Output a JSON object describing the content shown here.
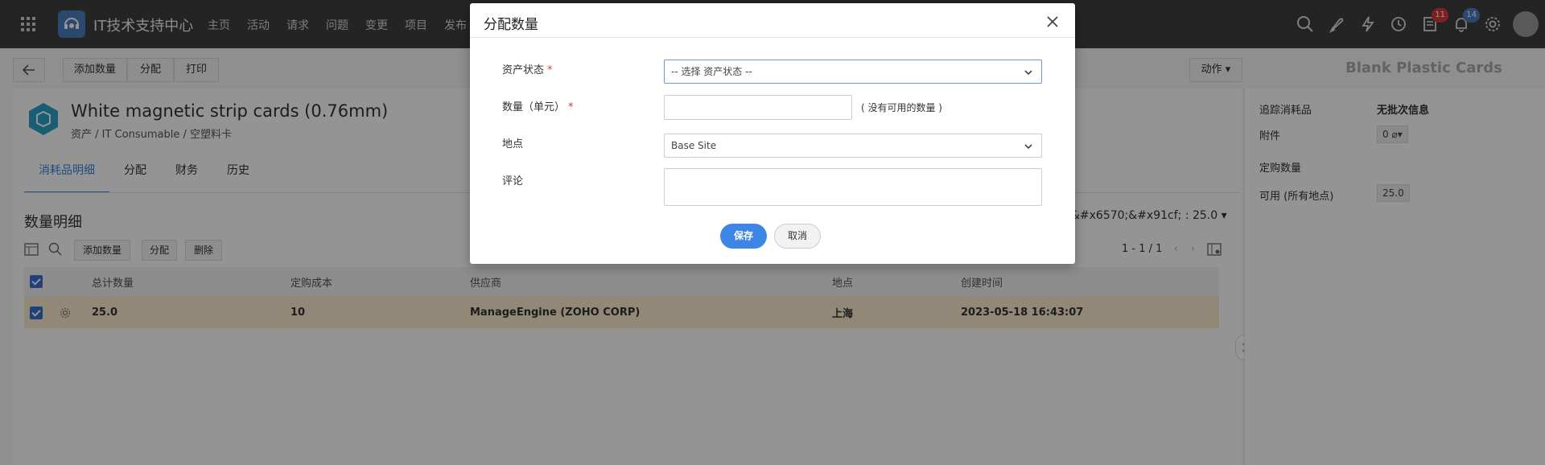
{
  "topbar": {
    "app_title": "IT技术支持中心",
    "nav": [
      "主页",
      "活动",
      "请求",
      "问题",
      "变更",
      "项目",
      "发布"
    ],
    "notifications_badge": "11",
    "alerts_badge": "14"
  },
  "toolbar": {
    "add_qty": "添加数量",
    "assign": "分配",
    "print": "打印",
    "actions": "动作",
    "right_title": "Blank Plastic Cards"
  },
  "asset": {
    "title": "White magnetic strip cards (0.76mm)",
    "breadcrumb": "资产  /  IT Consumable /  空塑料卡"
  },
  "tabs": [
    "消耗品明细",
    "分配",
    "财务",
    "历史"
  ],
  "section": {
    "title": "数量明细",
    "filter_text": "&#x6570;&#x91cf; : 25.0",
    "add_qty": "添加数量",
    "assign": "分配",
    "delete": "删除",
    "pager": "1 - 1 / 1"
  },
  "table": {
    "headers": [
      "总计数量",
      "定购成本",
      "供应商",
      "地点",
      "创建时间"
    ],
    "rows": [
      {
        "qty": "25.0",
        "cost": "10",
        "vendor": "ManageEngine (ZOHO CORP)",
        "site": "上海",
        "created": "2023-05-18 16:43:07"
      }
    ]
  },
  "right_panel": {
    "track_label": "追踪消耗品",
    "track_value": "无批次信息",
    "attach_label": "附件",
    "attach_value": "0",
    "order_qty_label": "定购数量",
    "available_label": "可用 (所有地点)",
    "available_value": "25.0"
  },
  "modal": {
    "title": "分配数量",
    "asset_status_label": "资产状态",
    "asset_status_value": "-- 选择 资产状态 --",
    "qty_label": "数量（单元）",
    "qty_note": "( 没有可用的数量 )",
    "site_label": "地点",
    "site_value": "Base Site",
    "comment_label": "评论",
    "save": "保存",
    "cancel": "取消"
  },
  "colors": {
    "accent": "#3e86e6",
    "topbar": "#3f3f3f",
    "selected_row": "#faebcf"
  }
}
